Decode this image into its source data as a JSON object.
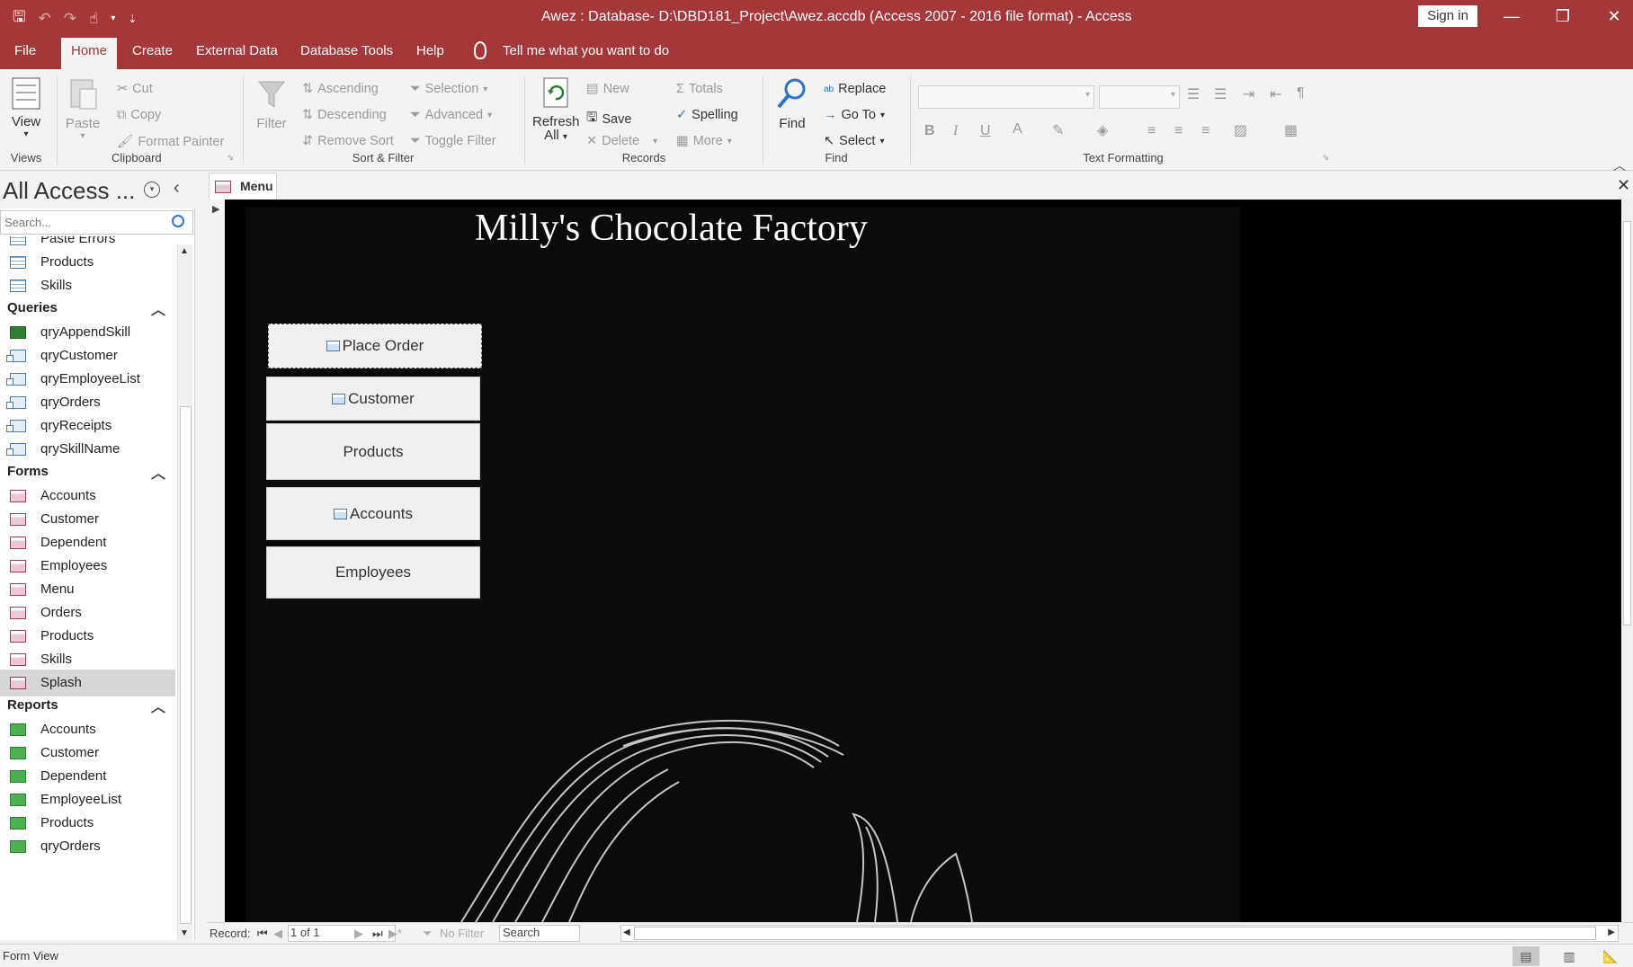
{
  "window": {
    "title": "Awez : Database- D:\\DBD181_Project\\Awez.accdb (Access 2007 - 2016 file format)  -  Access",
    "sign_in": "Sign in",
    "minimize": "—",
    "restore": "❐",
    "close": "✕"
  },
  "tabs": [
    {
      "label": "File"
    },
    {
      "label": "Home"
    },
    {
      "label": "Create"
    },
    {
      "label": "External Data"
    },
    {
      "label": "Database Tools"
    },
    {
      "label": "Help"
    }
  ],
  "tell_me": "Tell me what you want to do",
  "ribbon": {
    "views": {
      "group": "Views",
      "view": "View"
    },
    "clipboard": {
      "group": "Clipboard",
      "paste": "Paste",
      "cut": "Cut",
      "copy": "Copy",
      "format_painter": "Format Painter"
    },
    "sort_filter": {
      "group": "Sort & Filter",
      "filter": "Filter",
      "ascending": "Ascending",
      "descending": "Descending",
      "remove_sort": "Remove Sort",
      "selection": "Selection",
      "advanced": "Advanced",
      "toggle_filter": "Toggle Filter"
    },
    "records": {
      "group": "Records",
      "refresh": "Refresh",
      "refresh_all": "All",
      "new": "New",
      "save": "Save",
      "delete": "Delete",
      "totals": "Totals",
      "spelling": "Spelling",
      "more": "More"
    },
    "find": {
      "group": "Find",
      "find": "Find",
      "replace": "Replace",
      "goto": "Go To",
      "select": "Select"
    },
    "text_formatting": {
      "group": "Text Formatting",
      "bold": "B",
      "italic": "I",
      "underline": "U"
    }
  },
  "nav": {
    "title": "All Access ...",
    "search_placeholder": "Search...",
    "tables_partial": [
      {
        "label": "Paste Errors"
      },
      {
        "label": "Products"
      },
      {
        "label": "Skills"
      }
    ],
    "queries_label": "Queries",
    "queries": [
      {
        "label": "qryAppendSkill",
        "type": "append"
      },
      {
        "label": "qryCustomer",
        "type": "query"
      },
      {
        "label": "qryEmployeeList",
        "type": "query"
      },
      {
        "label": "qryOrders",
        "type": "query"
      },
      {
        "label": "qryReceipts",
        "type": "query"
      },
      {
        "label": "qrySkillName",
        "type": "query"
      }
    ],
    "forms_label": "Forms",
    "forms": [
      {
        "label": "Accounts"
      },
      {
        "label": "Customer"
      },
      {
        "label": "Dependent"
      },
      {
        "label": "Employees"
      },
      {
        "label": "Menu"
      },
      {
        "label": "Orders"
      },
      {
        "label": "Products"
      },
      {
        "label": "Skills"
      },
      {
        "label": "Splash"
      }
    ],
    "reports_label": "Reports",
    "reports": [
      {
        "label": "Accounts"
      },
      {
        "label": "Customer"
      },
      {
        "label": "Dependent"
      },
      {
        "label": "EmployeeList"
      },
      {
        "label": "Products"
      },
      {
        "label": "qryOrders"
      }
    ],
    "selected": "Splash"
  },
  "document": {
    "tab_label": "Menu",
    "form_title": "Milly's Chocolate Factory",
    "buttons": [
      {
        "label": "Place Order",
        "icon": true
      },
      {
        "label": "Customer",
        "icon": true
      },
      {
        "label": "Products",
        "icon": false
      },
      {
        "label": "Accounts",
        "icon": true
      },
      {
        "label": "Employees",
        "icon": false
      }
    ]
  },
  "record_bar": {
    "record_label": "Record:",
    "record_value": "1 of 1",
    "no_filter": "No Filter",
    "search": "Search"
  },
  "status": {
    "text": "Form View"
  },
  "colors": {
    "accent": "#a4373a",
    "form_background": "#0b0b0b"
  }
}
